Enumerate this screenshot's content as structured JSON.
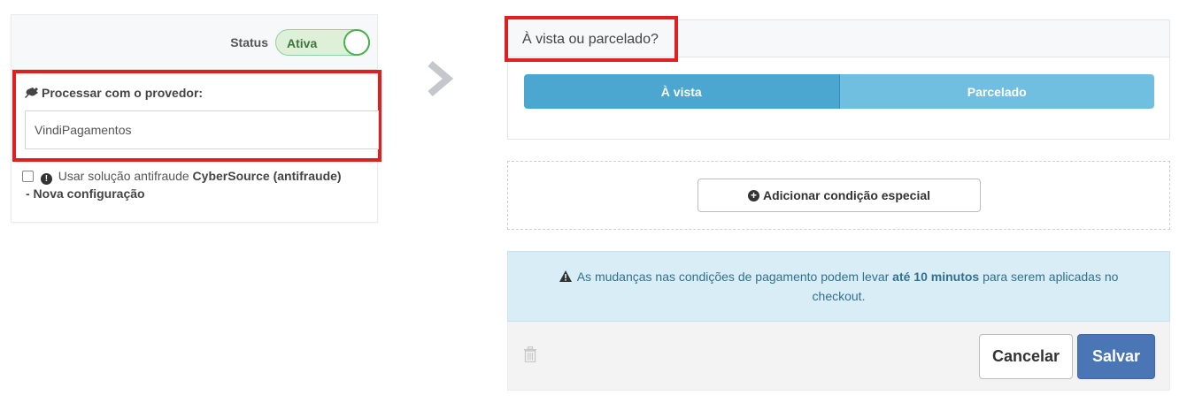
{
  "settings": {
    "status_label": "Status",
    "status_value": "Ativa",
    "status_on": true,
    "provider_label": "Processar com o provedor:",
    "provider_value": "VindiPagamentos",
    "antifraud": {
      "checked": false,
      "text_prefix": "Usar solução antifraude",
      "provider_name": "CyberSource (antifraude)",
      "config_suffix": "- Nova configuração"
    }
  },
  "payment": {
    "title": "À vista ou parcelado?",
    "options": [
      {
        "label": "À vista",
        "selected": true
      },
      {
        "label": "Parcelado",
        "selected": false
      }
    ],
    "add_condition_label": "Adicionar condição especial"
  },
  "notice": {
    "text_before": "As mudanças nas condições de pagamento podem levar",
    "highlight": "até 10 minutos",
    "text_after": "para serem aplicadas no checkout."
  },
  "footer": {
    "cancel_label": "Cancelar",
    "save_label": "Salvar"
  },
  "icons": {
    "plug": "plug-icon",
    "info": "exclamation-circle-icon",
    "arrow": "chevron-right-icon",
    "plus": "plus-circle-icon",
    "warning": "warning-triangle-icon",
    "trash": "trash-icon"
  },
  "colors": {
    "highlight_border": "#e02020",
    "toggle_bg": "#dff0d8",
    "toggle_text": "#3c763d",
    "segment_active": "#4ba7d0",
    "segment_inactive": "#71bfe0",
    "notice_bg": "#d9edf7",
    "save_button": "#4a76b6"
  }
}
